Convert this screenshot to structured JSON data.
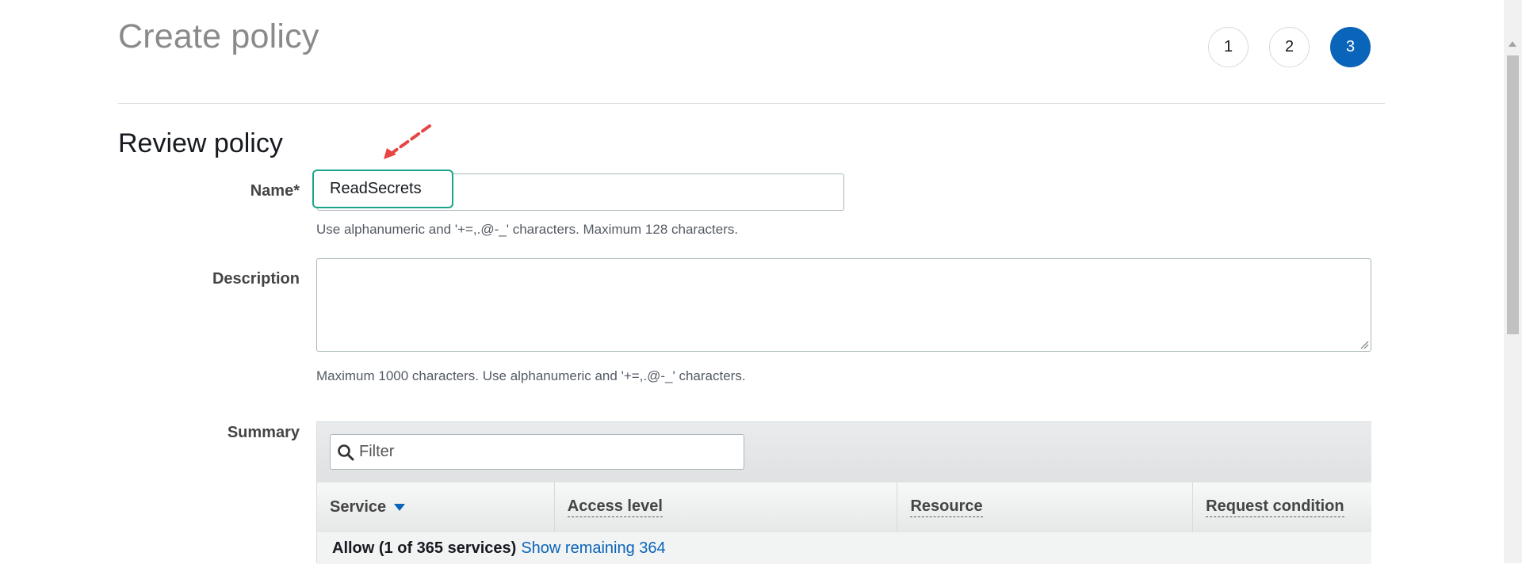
{
  "header": {
    "title": "Create policy",
    "steps": [
      "1",
      "2",
      "3"
    ],
    "active_step": "3"
  },
  "review": {
    "title": "Review policy",
    "name": {
      "label": "Name*",
      "value": "ReadSecrets",
      "hint": "Use alphanumeric and '+=,.@-_' characters. Maximum 128 characters."
    },
    "description": {
      "label": "Description",
      "value": "",
      "hint": "Maximum 1000 characters. Use alphanumeric and '+=,.@-_' characters."
    },
    "summary": {
      "label": "Summary",
      "filter_placeholder": "Filter",
      "columns": [
        "Service",
        "Access level",
        "Resource",
        "Request condition"
      ],
      "allow_text": "Allow (1 of 365 services)",
      "show_remaining_link": "Show remaining 364"
    }
  },
  "colors": {
    "accent": "#0a64b9",
    "annotation_box": "#1aa58b",
    "annotation_arrow": "#e84545"
  },
  "icons": [
    "search-icon",
    "sort-down-icon",
    "resize-grip-icon",
    "annotation-arrow-icon"
  ]
}
